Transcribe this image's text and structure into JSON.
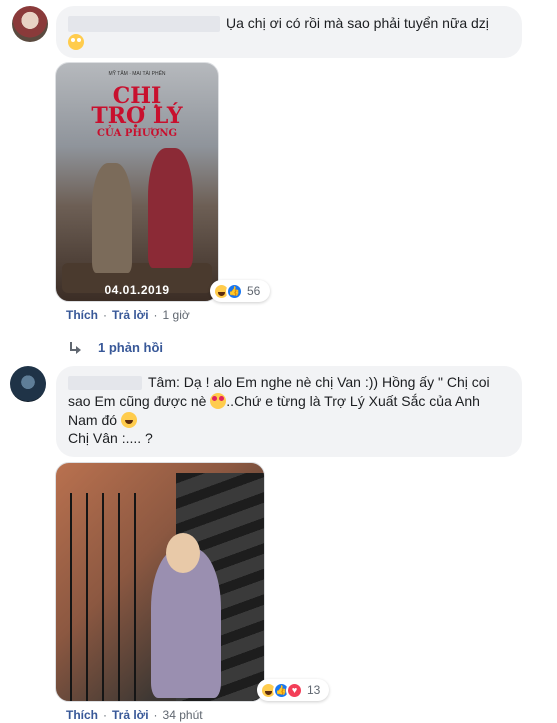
{
  "comment1": {
    "text": "Ụa chị ơi có rồi mà sao phải tuyển nữa dzị",
    "emoji": "face-with-rolling-eyes-icon",
    "poster": {
      "credits": "MỸ TÂM · MAI TÀI PHẾN",
      "title_line1": "CHỊ",
      "title_line2": "TRỢ LÝ",
      "title_line3": "CỦA PHƯỢNG",
      "date": "04.01.2019"
    },
    "reactions": {
      "icons": [
        "haha",
        "like"
      ],
      "count": "56"
    },
    "actions": {
      "like": "Thích",
      "reply": "Trả lời",
      "time": "1 giờ"
    },
    "replies_link": "1 phản hồi"
  },
  "comment2": {
    "text_part1": "Tâm: Dạ ! alo Em nghe nè chị Van :)) Hồng ấy \" Chị coi sao Em cũng được nè",
    "text_part2": "..Chứ e từng là Trợ Lý Xuất Sắc của Anh Nam đó",
    "text_part3": "Chị Vân :.... ?",
    "reactions": {
      "icons": [
        "haha",
        "like",
        "love"
      ],
      "count": "13"
    },
    "actions": {
      "like": "Thích",
      "reply": "Trả lời",
      "time": "34 phút"
    }
  },
  "colors": {
    "link": "#385898",
    "bubble": "#f2f3f5",
    "meta": "#606770",
    "like": "#1877f2",
    "love": "#f33e58",
    "haha": "#ffcc4d"
  }
}
